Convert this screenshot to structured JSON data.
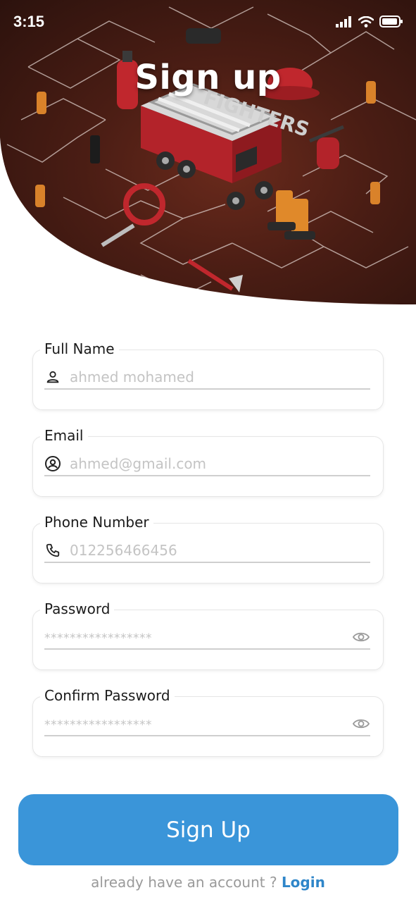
{
  "status_bar": {
    "time": "3:15",
    "icons": [
      "signal-icon",
      "wifi-icon",
      "battery-icon"
    ]
  },
  "header": {
    "title": "Sign up",
    "illustration": "firefighters-isometric-illustration",
    "illustration_text": "FIGHTERS",
    "background_color": "#4a1d14"
  },
  "form": {
    "full_name": {
      "label": "Full Name",
      "placeholder": "ahmed mohamed",
      "icon": "person-icon"
    },
    "email": {
      "label": "Email",
      "placeholder": "ahmed@gmail.com",
      "icon": "account-circle-icon"
    },
    "phone": {
      "label": "Phone Number",
      "placeholder": "012256466456",
      "icon": "phone-icon"
    },
    "password": {
      "label": "Password",
      "placeholder": "*****************",
      "icon": "eye-icon"
    },
    "confirm_password": {
      "label": "Confirm Password",
      "placeholder": "*****************",
      "icon": "eye-icon"
    }
  },
  "actions": {
    "signup_label": "Sign Up",
    "footer_text": "already have an account ? ",
    "login_label": "Login"
  },
  "colors": {
    "primary": "#3a95d9",
    "link": "#2f86c9",
    "placeholder": "#c4c4c4"
  }
}
